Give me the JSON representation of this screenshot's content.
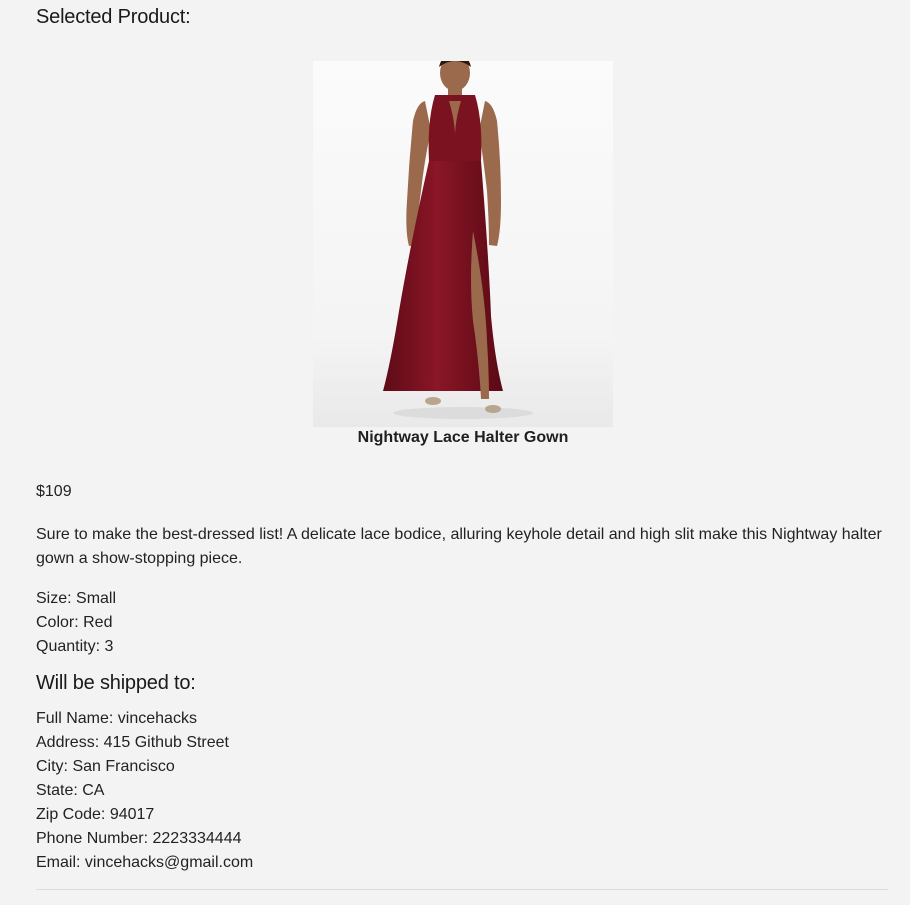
{
  "page": {
    "selected_heading": "Selected Product:"
  },
  "product": {
    "name": "Nightway Lace Halter Gown",
    "price": "$109",
    "description": "Sure to make the best-dressed list! A delicate lace bodice, alluring keyhole detail and high slit make this Nightway halter gown a show-stopping piece.",
    "size": "Size: Small",
    "color": "Color: Red",
    "quantity": "Quantity: 3",
    "image_alt": "Nightway Lace Halter Gown",
    "dress_color": "#7a1220"
  },
  "shipping": {
    "heading": "Will be shipped to:",
    "full_name": "Full Name: vincehacks",
    "address": "Address: 415 Github Street",
    "city": "City: San Francisco",
    "state": "State: CA",
    "zip": "Zip Code: 94017",
    "phone": "Phone Number: 2223334444",
    "email": "Email: vincehacks@gmail.com"
  }
}
